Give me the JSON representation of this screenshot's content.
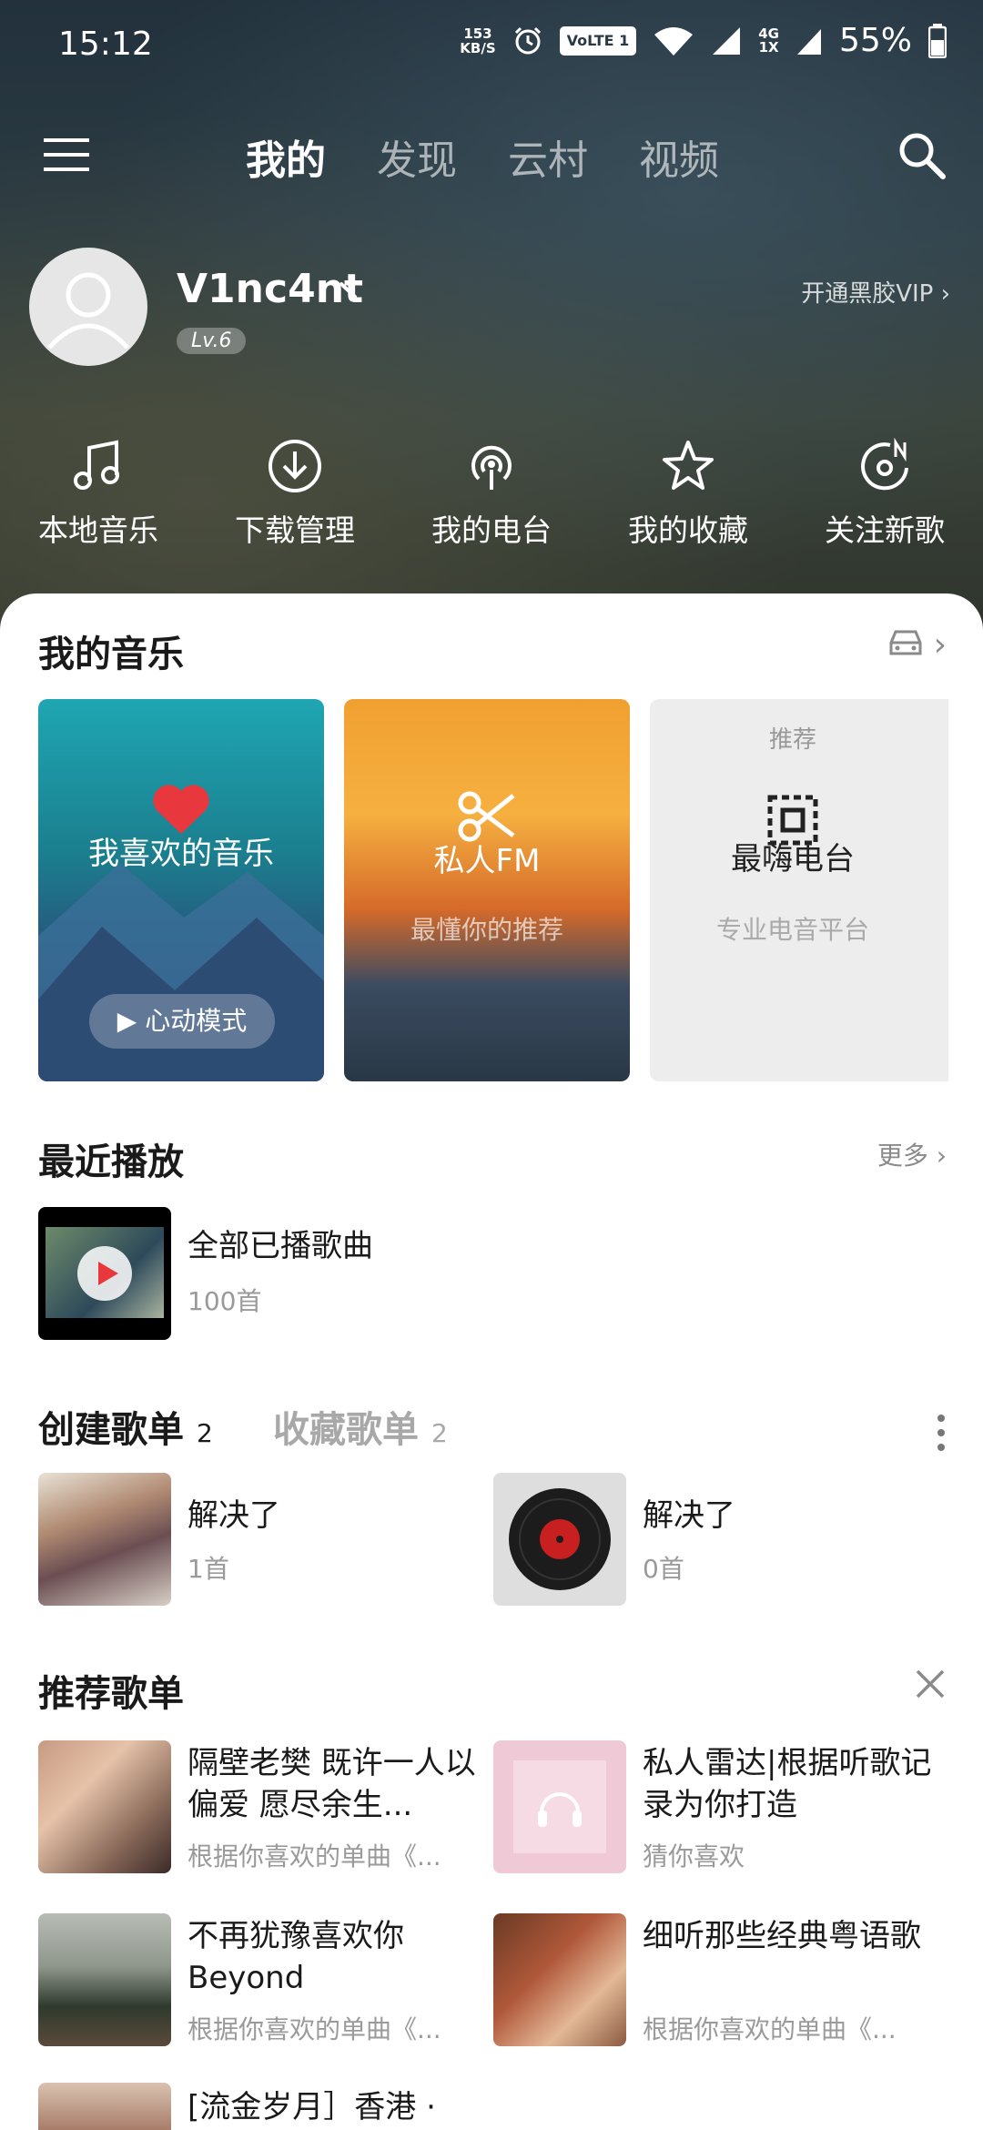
{
  "status_bar": {
    "time": "15:12",
    "net_speed_value": "153",
    "net_speed_unit": "KB/S",
    "volte": "VoLTE 1",
    "network_top": "4G",
    "network_bottom": "1X",
    "battery": "55%"
  },
  "top_nav": {
    "tabs": [
      {
        "label": "我的",
        "active": true
      },
      {
        "label": "发现",
        "active": false
      },
      {
        "label": "云村",
        "active": false
      },
      {
        "label": "视频",
        "active": false
      }
    ]
  },
  "profile": {
    "username": "V1nc4nt",
    "level": "Lv.6",
    "vip_link": "开通黑胶VIP"
  },
  "shortcuts": [
    {
      "label": "本地音乐",
      "icon": "music-note-icon"
    },
    {
      "label": "下载管理",
      "icon": "download-icon"
    },
    {
      "label": "我的电台",
      "icon": "podcast-icon"
    },
    {
      "label": "我的收藏",
      "icon": "star-icon"
    },
    {
      "label": "关注新歌",
      "icon": "new-song-icon"
    }
  ],
  "my_music": {
    "title": "我的音乐",
    "cards": {
      "liked": {
        "title": "我喜欢的音乐",
        "mode": "心动模式"
      },
      "fm": {
        "title": "私人FM",
        "subtitle": "最懂你的推荐"
      },
      "radio": {
        "tag": "推荐",
        "title": "最嗨电台",
        "subtitle": "专业电音平台"
      }
    }
  },
  "recent": {
    "title": "最近播放",
    "more": "更多",
    "item": {
      "title": "全部已播歌曲",
      "count": "100首"
    }
  },
  "playlists": {
    "created_label": "创建歌单",
    "created_count": "2",
    "collected_label": "收藏歌单",
    "collected_count": "2",
    "items": [
      {
        "title": "解决了",
        "count": "1首"
      },
      {
        "title": "解决了",
        "count": "0首"
      }
    ]
  },
  "recommended": {
    "title": "推荐歌单",
    "items": [
      {
        "title": "隔壁老樊 既许一人以偏爱 愿尽余生...",
        "subtitle": "根据你喜欢的单曲《..."
      },
      {
        "title": "私人雷达|根据听歌记录为你打造",
        "subtitle": "猜你喜欢"
      },
      {
        "title": "不再犹豫喜欢你Beyond",
        "subtitle": "根据你喜欢的单曲《..."
      },
      {
        "title": "细听那些经典粤语歌",
        "subtitle": "根据你喜欢的单曲《..."
      },
      {
        "title": "[流金岁月］香港 ·",
        "subtitle": ""
      }
    ]
  },
  "colors": {
    "accent_red": "#e8383d",
    "muted_text": "#9a9a9a"
  }
}
